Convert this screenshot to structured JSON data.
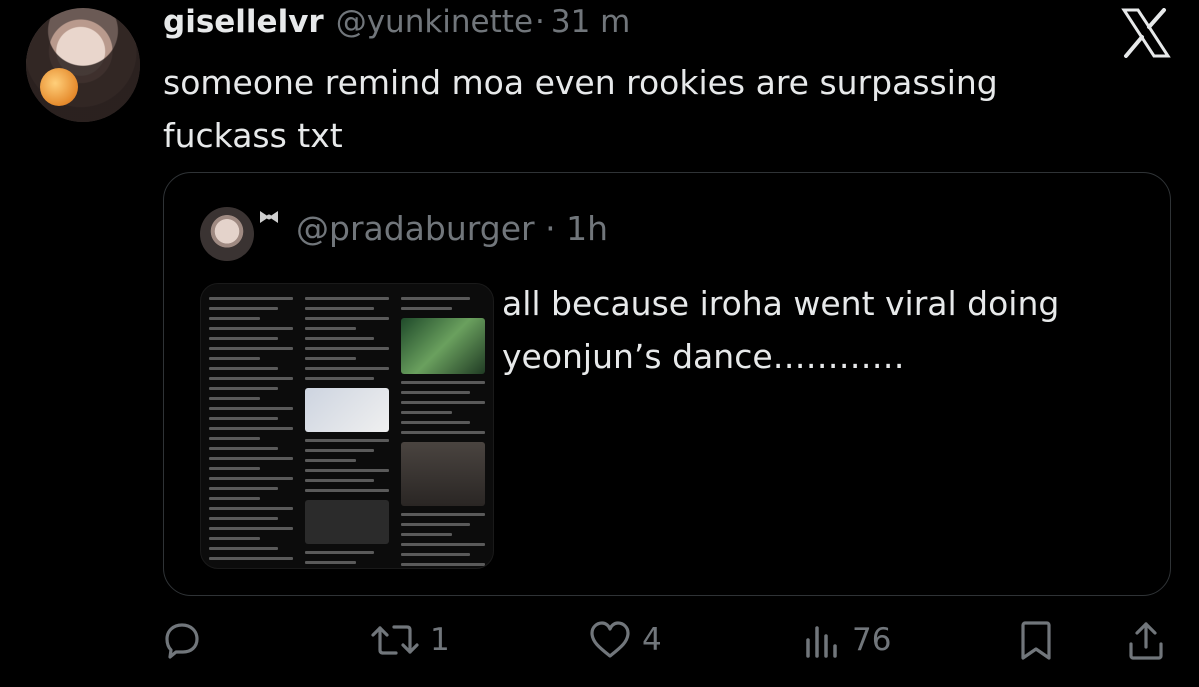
{
  "tweet": {
    "display_name": "gisellelvr",
    "handle": "@yunkinette",
    "separator": "·",
    "time": "31 m",
    "text": "someone remind moa even rookies are surpassing fuckass txt"
  },
  "quote": {
    "handle": "@pradaburger",
    "separator": "·",
    "time": "1h",
    "text": "all because iroha went viral doing yeonjun’s dance…………"
  },
  "actions": {
    "reply_count": "",
    "retweet_count": "1",
    "like_count": "4",
    "views_count": "76"
  },
  "icons": {
    "logo": "x-logo-icon",
    "reply": "reply-icon",
    "retweet": "retweet-icon",
    "like": "heart-icon",
    "views": "views-icon",
    "bookmark": "bookmark-icon",
    "share": "share-icon"
  },
  "colors": {
    "background": "#000000",
    "text": "#e7e9ea",
    "muted": "#71767b",
    "border": "#2f3336"
  }
}
